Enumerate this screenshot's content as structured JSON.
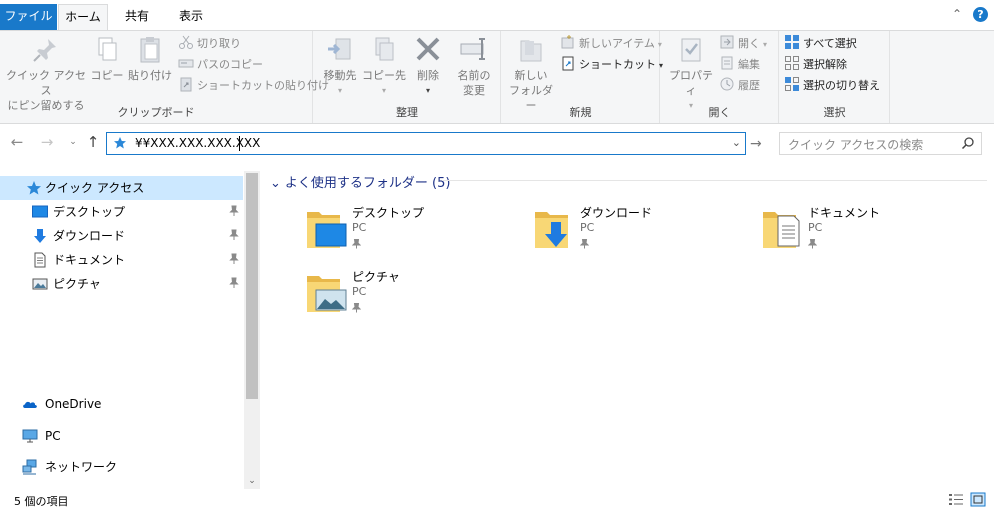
{
  "ribbon_tabs": {
    "file": "ファイル",
    "home": "ホーム",
    "share": "共有",
    "view": "表示"
  },
  "clipboard": {
    "pin_label_1": "クイック アクセス",
    "pin_label_2": "にピン留めする",
    "copy": "コピー",
    "paste": "貼り付け",
    "cut": "切り取り",
    "copy_path": "パスのコピー",
    "paste_shortcut": "ショートカットの貼り付け",
    "group": "クリップボード"
  },
  "organize": {
    "move_to": "移動先",
    "copy_to": "コピー先",
    "delete": "削除",
    "rename_1": "名前の",
    "rename_2": "変更",
    "group": "整理"
  },
  "new": {
    "new_folder_1": "新しい",
    "new_folder_2": "フォルダー",
    "new_item": "新しいアイテム",
    "shortcut": "ショートカット",
    "group": "新規"
  },
  "open": {
    "properties": "プロパティ",
    "open": "開く",
    "edit": "編集",
    "history": "履歴",
    "group": "開く"
  },
  "select": {
    "select_all": "すべて選択",
    "select_none": "選択解除",
    "invert": "選択の切り替え",
    "group": "選択"
  },
  "address": {
    "value": "¥¥XXX.XXX.XXX.XXX"
  },
  "search": {
    "placeholder": "クイック アクセスの検索"
  },
  "nav": {
    "quick_access": "クイック アクセス",
    "desktop": "デスクトップ",
    "downloads": "ダウンロード",
    "documents": "ドキュメント",
    "pictures": "ピクチャ",
    "onedrive": "OneDrive",
    "pc": "PC",
    "network": "ネットワーク"
  },
  "content": {
    "section_title": "よく使用するフォルダー (5)",
    "folders": [
      {
        "name": "デスクトップ",
        "location": "PC"
      },
      {
        "name": "ダウンロード",
        "location": "PC"
      },
      {
        "name": "ドキュメント",
        "location": "PC"
      },
      {
        "name": "ピクチャ",
        "location": "PC"
      }
    ]
  },
  "status": {
    "count": "5 個の項目"
  },
  "colors": {
    "accent": "#1979ca",
    "selection": "#cce8ff",
    "folder": "#f8d775",
    "ribbon_bg": "#f5f6f7"
  }
}
